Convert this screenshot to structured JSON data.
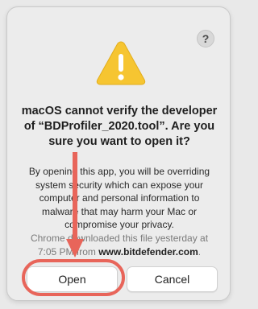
{
  "dialog": {
    "help_label": "?",
    "title": "macOS cannot verify the developer of “BDProfiler_2020.tool”. Are you sure you want to open it?",
    "body": "By opening this app, you will be overriding system security which can expose your computer and personal information to malware that may harm your Mac or compromise your privacy.",
    "source_prefix": "Chrome downloaded this file yesterday at 7:05 PM from ",
    "source_domain": "www.bitdefender.com",
    "source_suffix": ".",
    "open_label": "Open",
    "cancel_label": "Cancel"
  },
  "icons": {
    "warning": "warning-triangle-icon",
    "help": "question-mark-icon",
    "arrow": "down-arrow-annotation"
  },
  "colors": {
    "warning_yellow": "#f6c531",
    "annotation_red": "#e8655a"
  }
}
